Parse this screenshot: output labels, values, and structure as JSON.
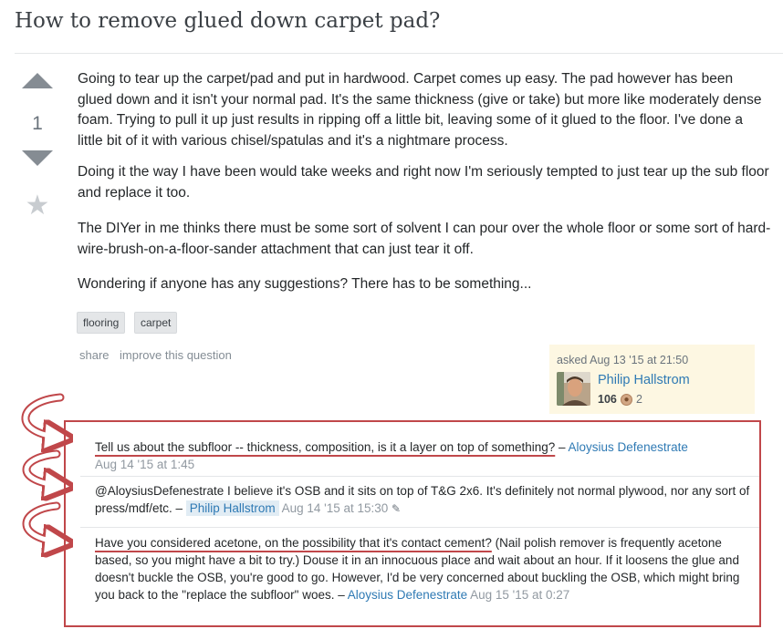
{
  "question": {
    "title": "How to remove glued down carpet pad?",
    "votes": "1",
    "body": [
      "Going to tear up the carpet/pad and put in hardwood. Carpet comes up easy. The pad however has been glued down and it isn't your normal pad. It's the same thickness (give or take) but more like moderately dense foam. Trying to pull it up just results in ripping off a little bit, leaving some of it glued to the floor. I've done a little bit of it with various chisel/spatulas and it's a nightmare process.",
      "Doing it the way I have been would take weeks and right now I'm seriously tempted to just tear up the sub floor and replace it too.",
      "The DIYer in me thinks there must be some sort of solvent I can pour over the whole floor or some sort of hard-wire-brush-on-a-floor-sander attachment that can just tear it off.",
      "Wondering if anyone has any suggestions? There has to be something..."
    ],
    "tags": [
      "flooring",
      "carpet"
    ],
    "menu": {
      "share": "share",
      "improve": "improve this question"
    },
    "signature": {
      "asked": "asked Aug 13 '15 at 21:50",
      "user": "Philip Hallstrom",
      "reputation": "106",
      "bronze_count": "2"
    }
  },
  "comments": [
    {
      "highlight": "Tell us about the subfloor -- thickness, composition, is it a layer on top of something?",
      "text": "",
      "sep": " – ",
      "user": "Aloysius Defenestrate",
      "date": "Aug 14 '15 at 1:45"
    },
    {
      "highlight": "",
      "text": "@AloysiusDefenestrate I believe it's OSB and it sits on top of T&G 2x6. It's definitely not normal plywood, nor any sort of press/mdf/etc.",
      "sep": " – ",
      "user": "Philip Hallstrom",
      "date": "Aug 14 '15 at 15:30"
    },
    {
      "highlight": "Have you considered acetone, on the possibility that it's contact cement?",
      "text": " (Nail polish remover is frequently acetone based, so you might have a bit to try.) Douse it in an innocuous place and wait about an hour. If it loosens the glue and doesn't buckle the OSB, you're good to go. However, I'd be very concerned about buckling the OSB, which might bring you back to the \"replace the subfloor\" woes.",
      "sep": " – ",
      "user": "Aloysius Defenestrate",
      "date": "Aug 15 '15 at 0:27"
    }
  ],
  "icons": {
    "upvote": "arrow-up-icon",
    "downvote": "arrow-down-icon",
    "favorite": "star-icon",
    "edit": "pencil-icon",
    "badge": "bronze-badge-icon",
    "annotation": "curved-arrow-icon"
  },
  "colors": {
    "link": "#2f7ab4",
    "annotation": "#c0474a",
    "signature_bg": "#fdf7e2",
    "tag_bg": "#e4e6e8"
  }
}
